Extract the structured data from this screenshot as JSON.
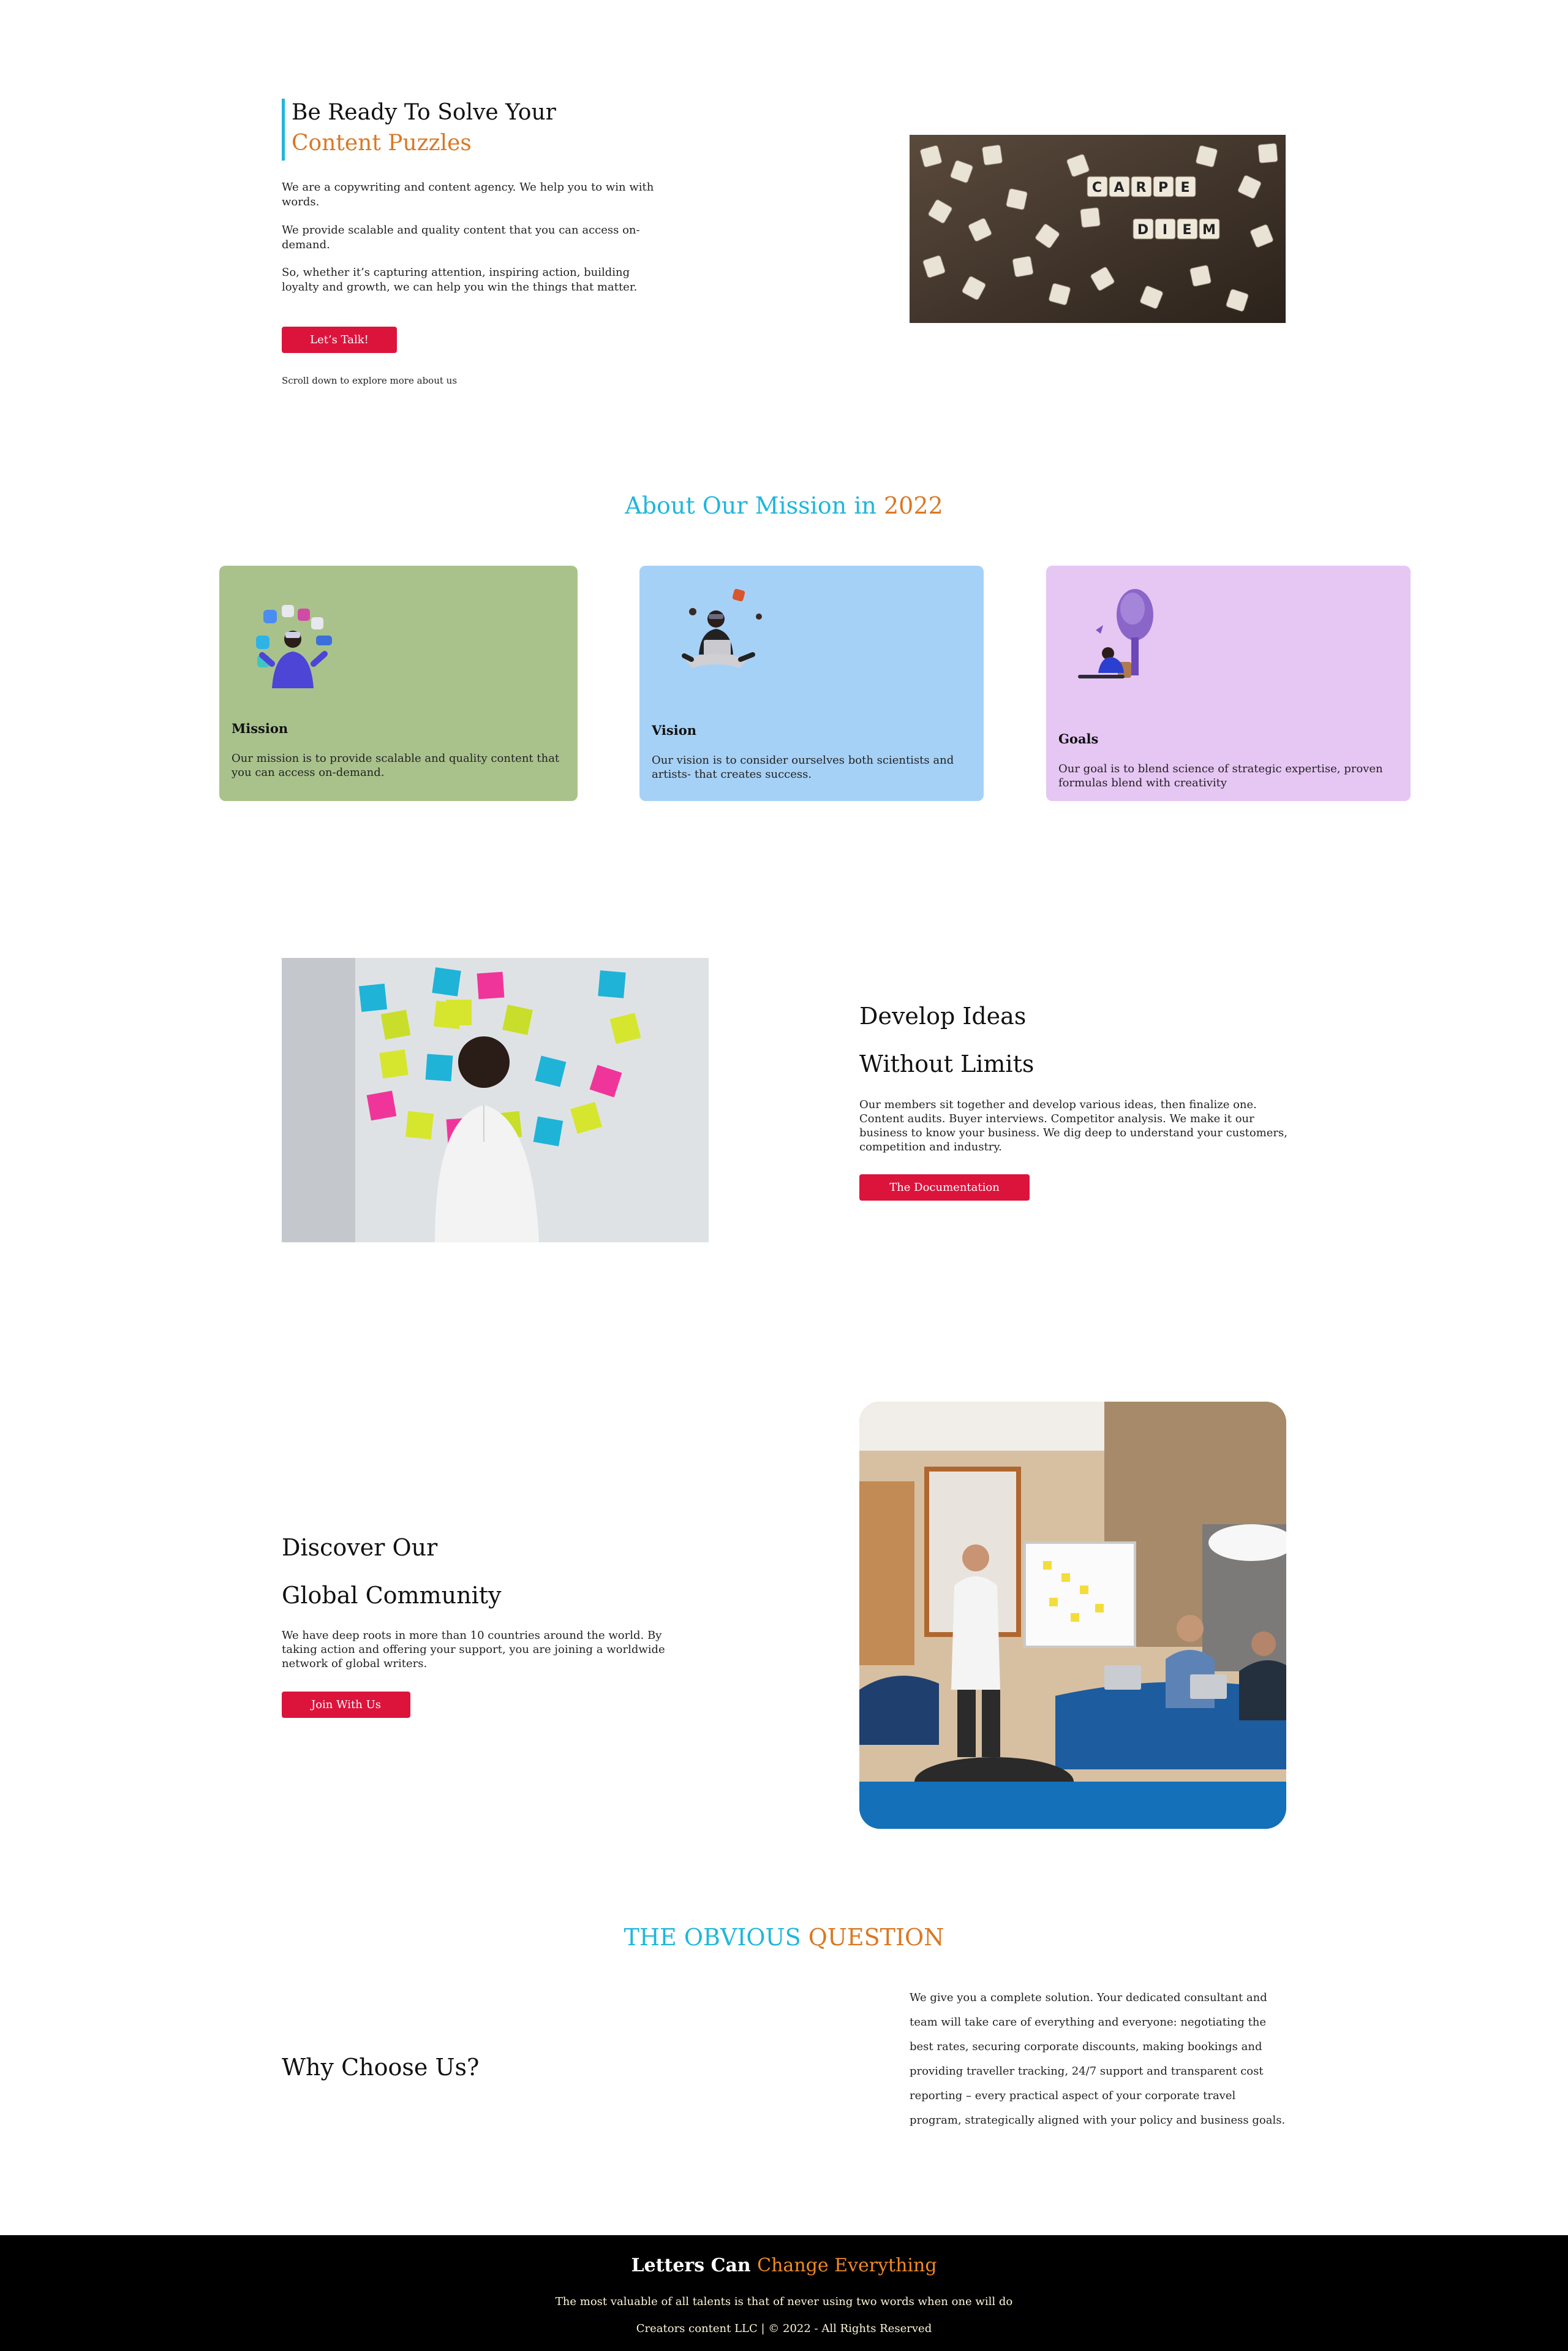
{
  "hero": {
    "title_line1": "Be Ready To Solve Your",
    "title_line2": "Content Puzzles",
    "para1": "We are a copywriting and content agency. We help you to win with words.",
    "para2": "We provide scalable and quality content that you can access on-demand.",
    "para3": "So, whether it’s capturing attention, inspiring action, building loyalty and growth, we can help you win the things that matter.",
    "button_label": "Let’s Talk!",
    "scroll_hint": "Scroll down to explore more about us",
    "image_tiles": [
      "CARPE",
      "DIEM"
    ]
  },
  "mission_section": {
    "heading_part1": "About Our Mission in",
    "heading_part2": "2022",
    "cards": [
      {
        "title": "Mission",
        "text": "Our mission is to provide scalable and quality content that you can access on-demand.",
        "color": "#a9c28c"
      },
      {
        "title": "Vision",
        "text": "Our vision is to consider ourselves both scientists and artists- that creates success.",
        "color": "#a6d1f7"
      },
      {
        "title": "Goals",
        "text": "Our goal is to blend science of strategic expertise, proven formulas blend with creativity",
        "color": "#e6c6f3"
      }
    ]
  },
  "develop": {
    "title_line1": "Develop Ideas",
    "title_line2": "Without Limits",
    "text": "Our members sit together and develop various ideas, then finalize one. Content audits. Buyer interviews. Competitor analysis. We make it our business to know your business. We dig deep to understand your customers, competition and industry.",
    "button_label": "The Documentation"
  },
  "community": {
    "title_line1": "Discover Our",
    "title_line2": "Global Community",
    "text": "We have deep roots in more than 10 countries around the world. By taking action and offering your support, you are joining a worldwide network of global writers.",
    "button_label": "Join With Us"
  },
  "question": {
    "heading_part1": "THE OBVIOUS",
    "heading_part2": "QUESTION",
    "title": "Why Choose Us?",
    "text": "We give you a complete solution. Your dedicated consultant and team will take care of everything and everyone: negotiating the best rates, securing corporate discounts, making bookings and providing traveller tracking, 24/7 support and transparent cost reporting – every practical aspect of your corporate travel program, strategically aligned with your policy and business goals."
  },
  "footer": {
    "title_part1": "Letters Can",
    "title_part2": "Change Everything",
    "quote": "The most valuable of all talents is that of never using two words when one will do",
    "copyright": "Creators content LLC | © 2022 - All Rights Reserved"
  },
  "colors": {
    "accent_orange": "#d97824",
    "accent_blue": "#1fb7db",
    "button_red": "#dc143c",
    "footer_bg": "#000000"
  }
}
